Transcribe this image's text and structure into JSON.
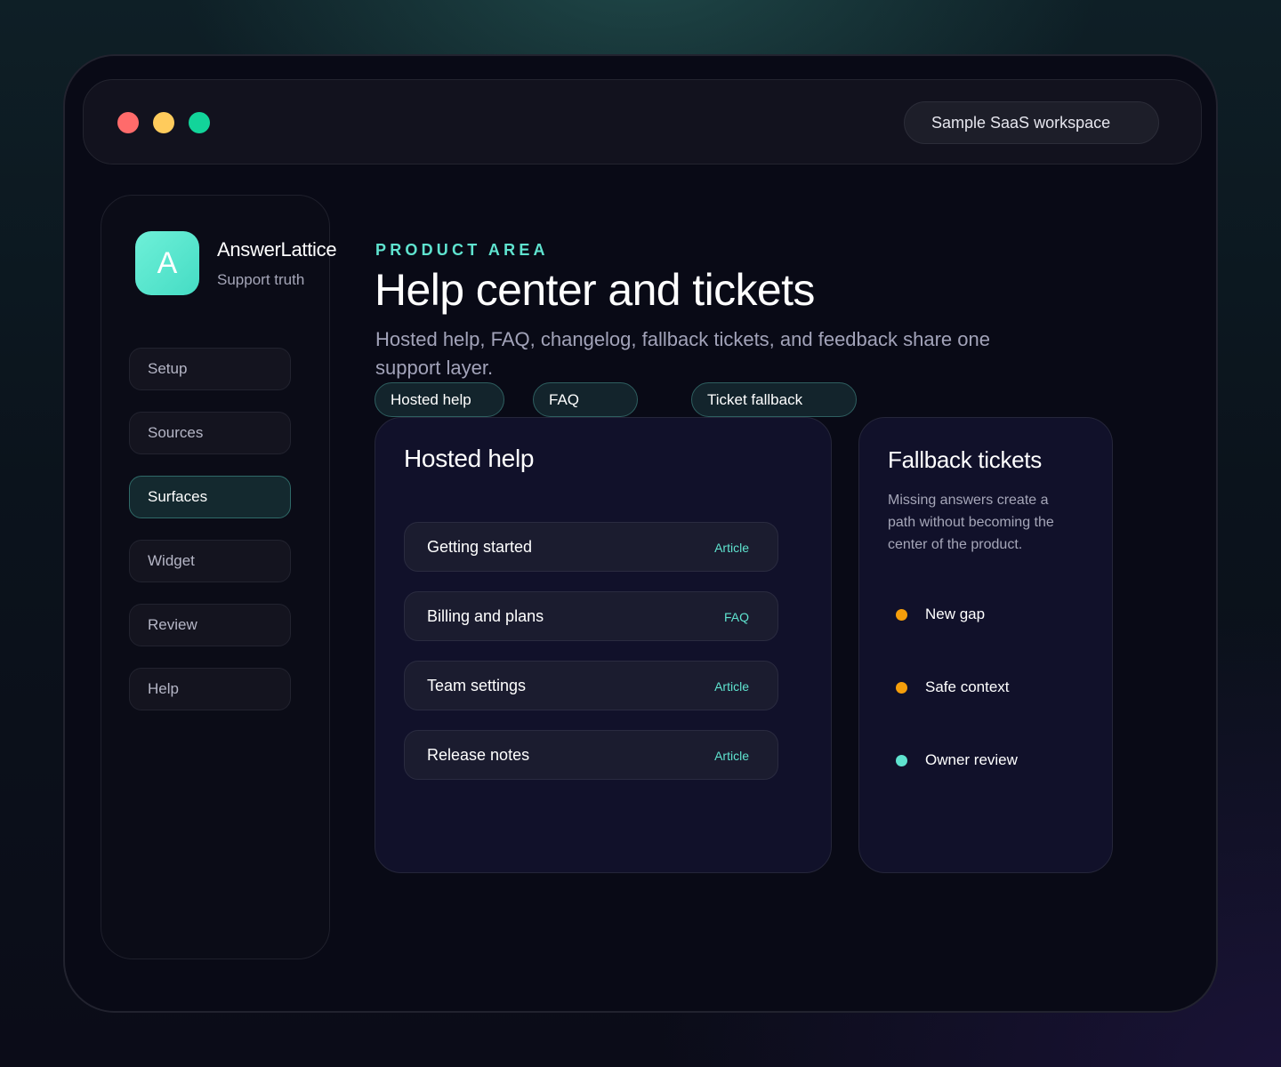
{
  "window": {
    "workspace_label": "Sample SaaS workspace"
  },
  "brand": {
    "logo_letter": "A",
    "name": "AnswerLattice",
    "tagline": "Support truth"
  },
  "sidebar": {
    "items": [
      {
        "label": "Setup",
        "active": false
      },
      {
        "label": "Sources",
        "active": false
      },
      {
        "label": "Surfaces",
        "active": true
      },
      {
        "label": "Widget",
        "active": false
      },
      {
        "label": "Review",
        "active": false
      },
      {
        "label": "Help",
        "active": false
      }
    ]
  },
  "header": {
    "eyebrow": "PRODUCT AREA",
    "title": "Help center and tickets",
    "description": "Hosted help, FAQ, changelog, fallback tickets, and feedback share one support layer."
  },
  "chips": [
    {
      "label": "Hosted help"
    },
    {
      "label": "FAQ"
    },
    {
      "label": "Ticket fallback"
    }
  ],
  "hosted_help": {
    "title": "Hosted help",
    "rows": [
      {
        "label": "Getting started",
        "tag": "Article"
      },
      {
        "label": "Billing and plans",
        "tag": "FAQ"
      },
      {
        "label": "Team settings",
        "tag": "Article"
      },
      {
        "label": "Release notes",
        "tag": "Article"
      }
    ]
  },
  "fallback": {
    "title": "Fallback tickets",
    "description": "Missing answers create a path without becoming the center of the product.",
    "statuses": [
      {
        "label": "New gap",
        "color": "#f59e0b"
      },
      {
        "label": "Safe context",
        "color": "#f59e0b"
      },
      {
        "label": "Owner review",
        "color": "#5fe3cf"
      }
    ]
  },
  "colors": {
    "accent": "#5fe3cf",
    "window_dot_red": "#ff6b6b",
    "window_dot_yellow": "#ffcb5c",
    "window_dot_green": "#12d49a"
  }
}
